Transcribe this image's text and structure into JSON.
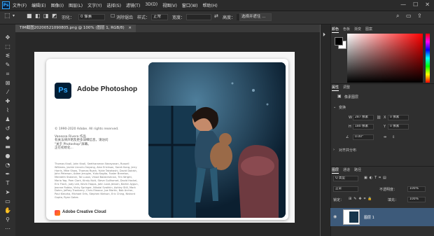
{
  "menubar": {
    "app_icon": "Ps",
    "menus": [
      "文件(F)",
      "编辑(E)",
      "图像(I)",
      "图层(L)",
      "文字(Y)",
      "选择(S)",
      "滤镜(T)",
      "3D(D)",
      "视图(V)",
      "窗口(W)",
      "帮助(H)"
    ],
    "window_controls": [
      "—",
      "☐",
      "✕"
    ]
  },
  "options_bar": {
    "feather_label": "羽化：",
    "feather_value": "0 像素",
    "anti_alias_label": "消除锯齿",
    "style_label": "样式：",
    "style_value": "正常",
    "width_label": "宽度：",
    "height_label": "高度：",
    "select_mask_button": "选择并遮住 ..."
  },
  "document_tab": {
    "label": "TIM截图20200521090805.png @ 100% (图层 1, RGB/8)",
    "close": "×"
  },
  "splash": {
    "logo": "Ps",
    "app_name": "Adobe Photoshop",
    "copyright": "© 1990-2020 Adobe. All rights reserved.",
    "version_lines": [
      "Vanessa Rivera 作品",
      "有关法律声明及更多详细信息，请访问",
      "\"关于 Photoshop\"屏幕。",
      "正在初始化..."
    ],
    "credits": "Thomas Knoll, John Knoll, Seetharaman Narayanan, Russell Williams, Jackie Lincoln-Owyang, Alan Erickson, Sarah Kong, Jerry Harris, Mike Shaw, Thomas Ruark, Yukie Takahashi, David Dobish, John Peterson, Adam Jerugim, Yuko Kagita, Foster Brereton, Meredith Stotzner, Tai Luxon, Vinod Balakrishnan, Tim Wright, Maria Yap, Pam Clark, Kirsty Nutt, Steve Guilhamet, David Hackel, Eric Floch, Judy Lee, Kevin Hopps, John Love-Jensen, Barkin Aygun, Jeanne Rubbo, Vicky Springer, Nikolai Svakhin, Ashley Still, Mark Dahm, Jeffrey Tranberry, Chris Eleanor, Joe Martin, Bob Archer, Paul Kleczka, Michael Orts, Stephen Nielson, Eric Ching, Nishant Gupta, Ryan Gates",
    "cc_name": "Adobe Creative Cloud"
  },
  "panels": {
    "color_tabs": [
      "颜色",
      "色板",
      "渐变",
      "图案"
    ],
    "properties_tabs": [
      "属性",
      "调整"
    ],
    "pixel_layer_label": "像素图层",
    "transform_label": "变换",
    "w_label": "W",
    "w_value": "287 像素",
    "h_label": "H",
    "h_value": "180 像素",
    "x_label": "X",
    "x_value": "0 像素",
    "y_label": "Y",
    "y_value": "0 像素",
    "angle_value": "0.00°",
    "align_label": "对齐并分布",
    "layers_tabs": [
      "图层",
      "通道",
      "路径"
    ],
    "kind_filter": "Q 类型",
    "blend_mode": "正常",
    "opacity_label": "不透明度：",
    "opacity_value": "100%",
    "lock_label": "锁定：",
    "fill_label": "填充：",
    "fill_value": "100%",
    "layer_name": "图层 1"
  },
  "colors": {
    "accent": "#31a8ff",
    "selected_layer": "#3d5a7a"
  }
}
